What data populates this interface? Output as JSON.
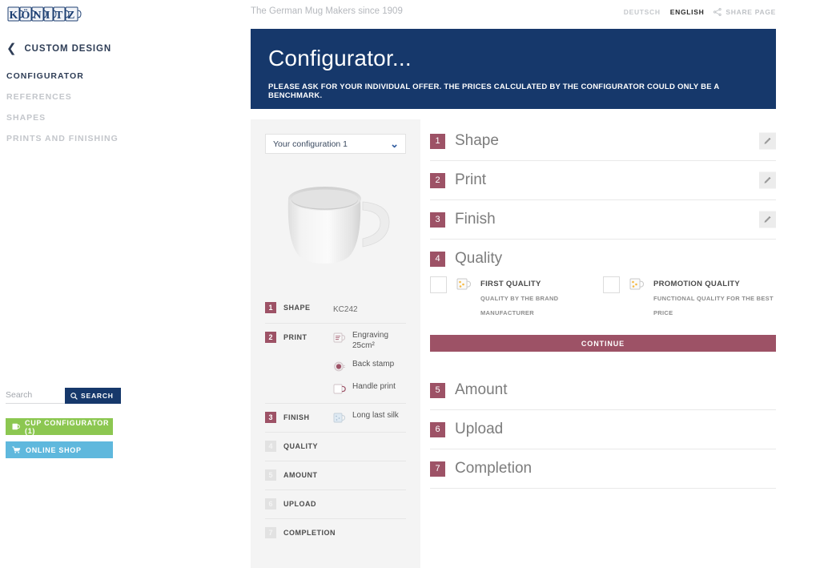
{
  "brand": {
    "logo_text": "KÖNITZ",
    "logo_letters": [
      "K",
      "Ö",
      "N",
      "I",
      "T",
      "Z"
    ]
  },
  "sidebar": {
    "back_label": "CUSTOM DESIGN",
    "back_icon": "chevron-left-icon",
    "items": [
      {
        "label": "CONFIGURATOR",
        "active": true
      },
      {
        "label": "REFERENCES",
        "active": false
      },
      {
        "label": "SHAPES",
        "active": false
      },
      {
        "label": "PRINTS AND FINISHING",
        "active": false
      }
    ],
    "search": {
      "placeholder": "Search",
      "value": "",
      "button_label": "SEARCH",
      "button_icon": "search-icon"
    },
    "buttons": [
      {
        "label": "CUP CONFIGURATOR (1)",
        "icon": "cup-icon",
        "color": "#8cc751"
      },
      {
        "label": "ONLINE SHOP",
        "icon": "cart-icon",
        "color": "#5fb8dd"
      }
    ]
  },
  "topbar": {
    "tagline": "The German Mug Makers since 1909",
    "lang_de": "DEUTSCH",
    "lang_en": "ENGLISH",
    "share_label": "SHARE PAGE",
    "share_icon": "share-icon"
  },
  "banner": {
    "title": "Configurator...",
    "subtitle": "PLEASE ASK FOR YOUR INDIVIDUAL OFFER. THE PRICES CALCULATED BY THE CONFIGURATOR COULD ONLY BE A BENCHMARK.",
    "color": "#16386b"
  },
  "config_panel": {
    "select_value": "Your configuration 1",
    "select_icon": "chevron-down-icon",
    "preview_alt": "white-mug-preview",
    "summary": [
      {
        "num": "1",
        "label": "SHAPE",
        "active": true,
        "plain_value": "KC242",
        "values": []
      },
      {
        "num": "2",
        "label": "PRINT",
        "active": true,
        "plain_value": "",
        "values": [
          {
            "text": "Engraving 25cm²",
            "icon": "mug-engraving-icon"
          },
          {
            "text": "Back stamp",
            "icon": "back-stamp-icon"
          },
          {
            "text": "Handle print",
            "icon": "handle-print-icon"
          }
        ]
      },
      {
        "num": "3",
        "label": "FINISH",
        "active": true,
        "plain_value": "",
        "values": [
          {
            "text": "Long last silk",
            "icon": "mug-finish-icon"
          }
        ]
      },
      {
        "num": "4",
        "label": "QUALITY",
        "active": false,
        "plain_value": "",
        "values": []
      },
      {
        "num": "5",
        "label": "AMOUNT",
        "active": false,
        "plain_value": "",
        "values": []
      },
      {
        "num": "6",
        "label": "UPLOAD",
        "active": false,
        "plain_value": "",
        "values": []
      },
      {
        "num": "7",
        "label": "COMPLETION",
        "active": false,
        "plain_value": "",
        "values": []
      }
    ]
  },
  "steps": {
    "accent_color": "#9d5266",
    "list": [
      {
        "num": "1",
        "title": "Shape",
        "edit_icon": "pencil-icon",
        "open": false
      },
      {
        "num": "2",
        "title": "Print",
        "edit_icon": "pencil-icon",
        "open": false
      },
      {
        "num": "3",
        "title": "Finish",
        "edit_icon": "pencil-icon",
        "open": false
      },
      {
        "num": "4",
        "title": "Quality",
        "edit_icon": "",
        "open": true
      },
      {
        "num": "5",
        "title": "Amount",
        "edit_icon": "",
        "open": false
      },
      {
        "num": "6",
        "title": "Upload",
        "edit_icon": "",
        "open": false
      },
      {
        "num": "7",
        "title": "Completion",
        "edit_icon": "",
        "open": false
      }
    ],
    "quality": {
      "options": [
        {
          "name": "FIRST QUALITY",
          "desc": "QUALITY BY THE BRAND MANUFACTURER",
          "icon": "quality-mug-icon",
          "checked": false
        },
        {
          "name": "PROMOTION QUALITY",
          "desc": "FUNCTIONAL QUALITY FOR THE BEST PRICE",
          "icon": "quality-mug-icon",
          "checked": false
        }
      ],
      "continue_label": "CONTINUE"
    }
  }
}
